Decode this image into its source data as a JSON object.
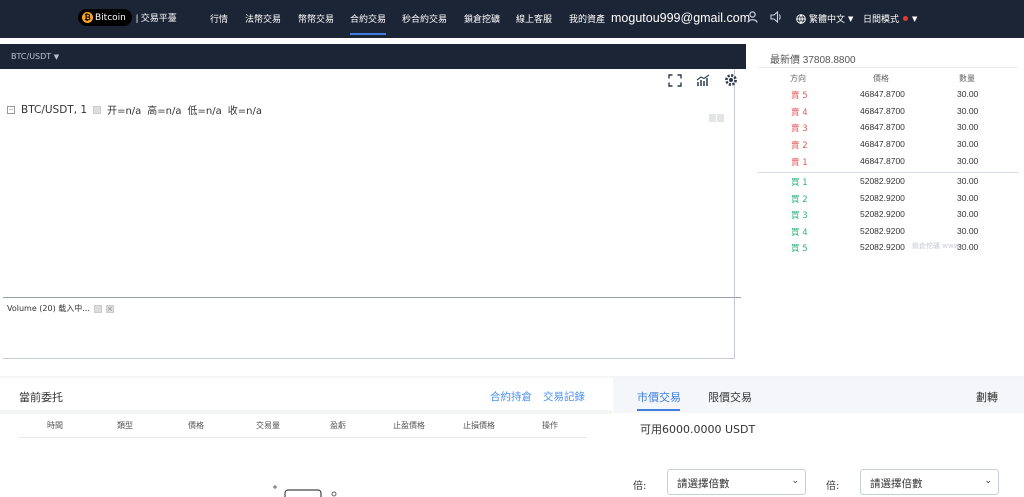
{
  "header": {
    "brand": "Bitcoin",
    "platform": "| 交易平臺",
    "nav": [
      "行情",
      "法幣交易",
      "幣幣交易",
      "合約交易",
      "秒合約交易",
      "鎖倉挖礦",
      "線上客服",
      "我的資產"
    ],
    "active_nav": "合約交易",
    "email": "mogutou999@gmail.com",
    "language": "繁體中文",
    "mode": "日間模式"
  },
  "chart": {
    "pair_selector": "BTC/USDT",
    "symbol_line": "BTC/USDT, 1",
    "ohlc": [
      "开=n/a",
      "高=n/a",
      "低=n/a",
      "收=n/a"
    ],
    "volume_label": "Volume (20) 载入中..."
  },
  "orderbook": {
    "last_price": "最新價 37808.8800",
    "columns": [
      "方向",
      "價格",
      "數量"
    ],
    "asks": [
      {
        "side": "賣 5",
        "price": "46847.8700",
        "qty": "30.00"
      },
      {
        "side": "賣 4",
        "price": "46847.8700",
        "qty": "30.00"
      },
      {
        "side": "賣 3",
        "price": "46847.8700",
        "qty": "30.00"
      },
      {
        "side": "賣 2",
        "price": "46847.8700",
        "qty": "30.00"
      },
      {
        "side": "賣 1",
        "price": "46847.8700",
        "qty": "30.00"
      }
    ],
    "bids": [
      {
        "side": "買 1",
        "price": "52082.9200",
        "qty": "30.00"
      },
      {
        "side": "買 2",
        "price": "52082.9200",
        "qty": "30.00"
      },
      {
        "side": "買 3",
        "price": "52082.9200",
        "qty": "30.00"
      },
      {
        "side": "買 4",
        "price": "52082.9200",
        "qty": "30.00"
      },
      {
        "side": "買 5",
        "price": "52082.9200",
        "qty": "30.00"
      }
    ],
    "watermark": "鎖倉挖礦 www.c..."
  },
  "orders": {
    "title": "當前委托",
    "links": [
      "合約持倉",
      "交易記錄"
    ],
    "columns": [
      "時間",
      "類型",
      "價格",
      "交易量",
      "盈虧",
      "止盈價格",
      "止損價格",
      "操作"
    ]
  },
  "trade": {
    "tabs": [
      "市價交易",
      "限價交易"
    ],
    "right_tab": "劃轉",
    "available": "可用6000.0000 USDT",
    "leverage_label": "倍:",
    "leverage_placeholder": "請選擇倍數"
  },
  "colors": {
    "nav_bg": "#1c2536",
    "accent": "#3c7fe0",
    "sell": "#e05a5a",
    "buy": "#2fb27a"
  }
}
